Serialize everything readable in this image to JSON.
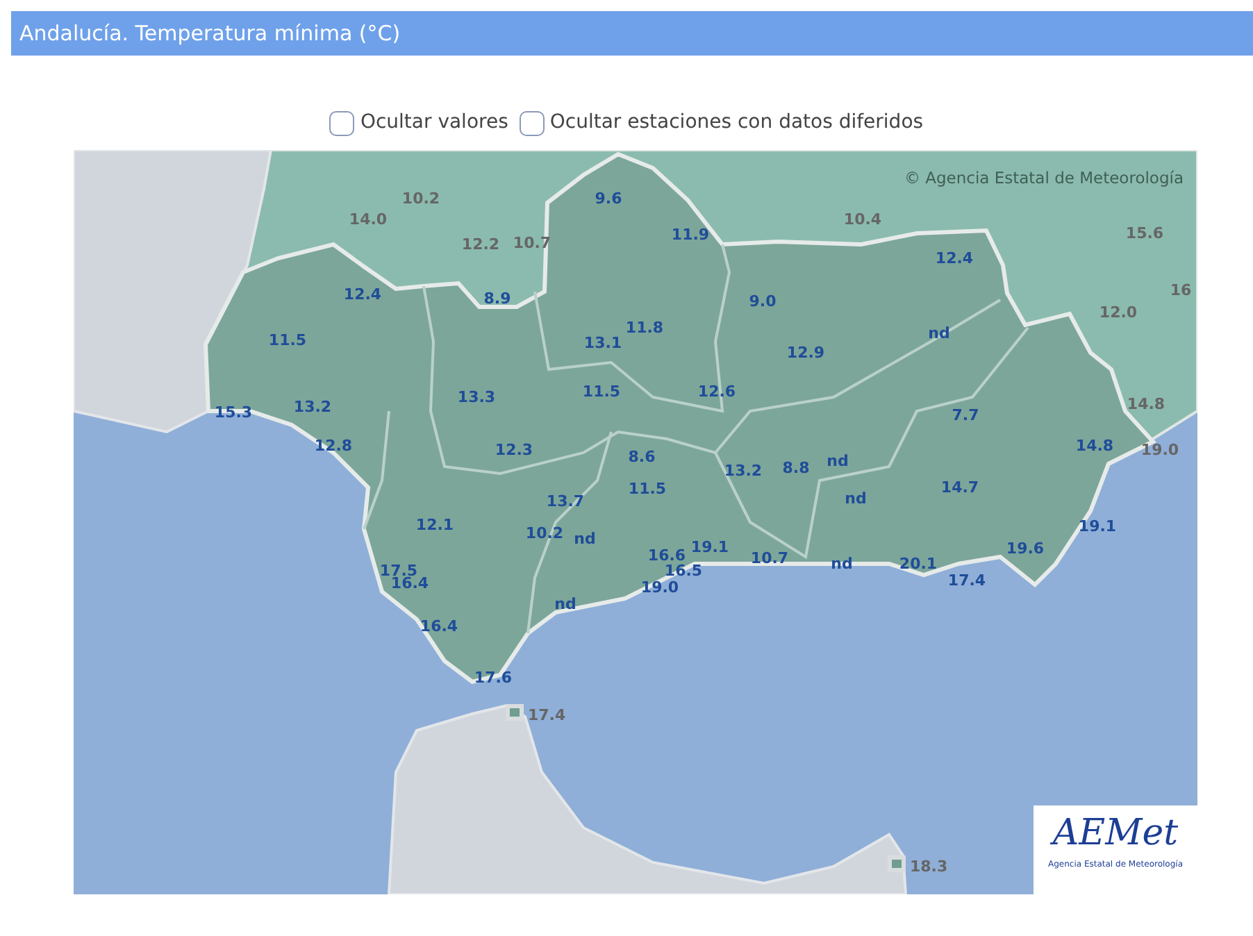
{
  "header": {
    "title": "Andalucía. Temperatura mínima (°C)"
  },
  "options": [
    {
      "label": "Ocultar valores",
      "checked": false
    },
    {
      "label": "Ocultar estaciones con datos diferidos",
      "checked": false
    }
  ],
  "map": {
    "attribution": "© Agencia Estatal de Meteorología",
    "logo": {
      "text": "AEMet",
      "subtitle": "Agencia Estatal de Meteorología"
    },
    "stations": [
      {
        "value": "14.0",
        "kind": "outside"
      },
      {
        "value": "10.2",
        "kind": "outside"
      },
      {
        "value": "12.2",
        "kind": "outside"
      },
      {
        "value": "10.7",
        "kind": "outside"
      },
      {
        "value": "10.4",
        "kind": "outside"
      },
      {
        "value": "15.6",
        "kind": "outside"
      },
      {
        "value": "16",
        "kind": "outside"
      },
      {
        "value": "12.0",
        "kind": "outside"
      },
      {
        "value": "14.8",
        "kind": "outside"
      },
      {
        "value": "19.0",
        "kind": "outside"
      },
      {
        "value": "17.4",
        "kind": "enclave"
      },
      {
        "value": "18.3",
        "kind": "enclave"
      },
      {
        "value": "9.6",
        "kind": "region"
      },
      {
        "value": "11.9",
        "kind": "region"
      },
      {
        "value": "12.4",
        "kind": "region"
      },
      {
        "value": "8.9",
        "kind": "region"
      },
      {
        "value": "9.0",
        "kind": "region"
      },
      {
        "value": "12.4",
        "kind": "region"
      },
      {
        "value": "11.5",
        "kind": "region"
      },
      {
        "value": "13.1",
        "kind": "region"
      },
      {
        "value": "11.8",
        "kind": "region"
      },
      {
        "value": "12.9",
        "kind": "region"
      },
      {
        "value": "nd",
        "kind": "region"
      },
      {
        "value": "15.3",
        "kind": "region"
      },
      {
        "value": "13.2",
        "kind": "region"
      },
      {
        "value": "13.3",
        "kind": "region"
      },
      {
        "value": "11.5",
        "kind": "region"
      },
      {
        "value": "12.6",
        "kind": "region"
      },
      {
        "value": "7.7",
        "kind": "region"
      },
      {
        "value": "12.8",
        "kind": "region"
      },
      {
        "value": "12.3",
        "kind": "region"
      },
      {
        "value": "8.6",
        "kind": "region"
      },
      {
        "value": "13.2",
        "kind": "region"
      },
      {
        "value": "8.8",
        "kind": "region"
      },
      {
        "value": "nd",
        "kind": "region"
      },
      {
        "value": "14.8",
        "kind": "region"
      },
      {
        "value": "13.7",
        "kind": "region"
      },
      {
        "value": "11.5",
        "kind": "region"
      },
      {
        "value": "nd",
        "kind": "region"
      },
      {
        "value": "14.7",
        "kind": "region"
      },
      {
        "value": "12.1",
        "kind": "region"
      },
      {
        "value": "10.2",
        "kind": "region"
      },
      {
        "value": "nd",
        "kind": "region"
      },
      {
        "value": "19.1",
        "kind": "region"
      },
      {
        "value": "17.5",
        "kind": "region"
      },
      {
        "value": "16.4",
        "kind": "region"
      },
      {
        "value": "16.6",
        "kind": "region"
      },
      {
        "value": "19.1",
        "kind": "region"
      },
      {
        "value": "10.7",
        "kind": "region"
      },
      {
        "value": "nd",
        "kind": "region"
      },
      {
        "value": "20.1",
        "kind": "region"
      },
      {
        "value": "19.6",
        "kind": "region"
      },
      {
        "value": "16.5",
        "kind": "region"
      },
      {
        "value": "17.4",
        "kind": "region"
      },
      {
        "value": "nd",
        "kind": "region"
      },
      {
        "value": "19.0",
        "kind": "region"
      },
      {
        "value": "16.4",
        "kind": "region"
      },
      {
        "value": "17.6",
        "kind": "region"
      }
    ]
  }
}
